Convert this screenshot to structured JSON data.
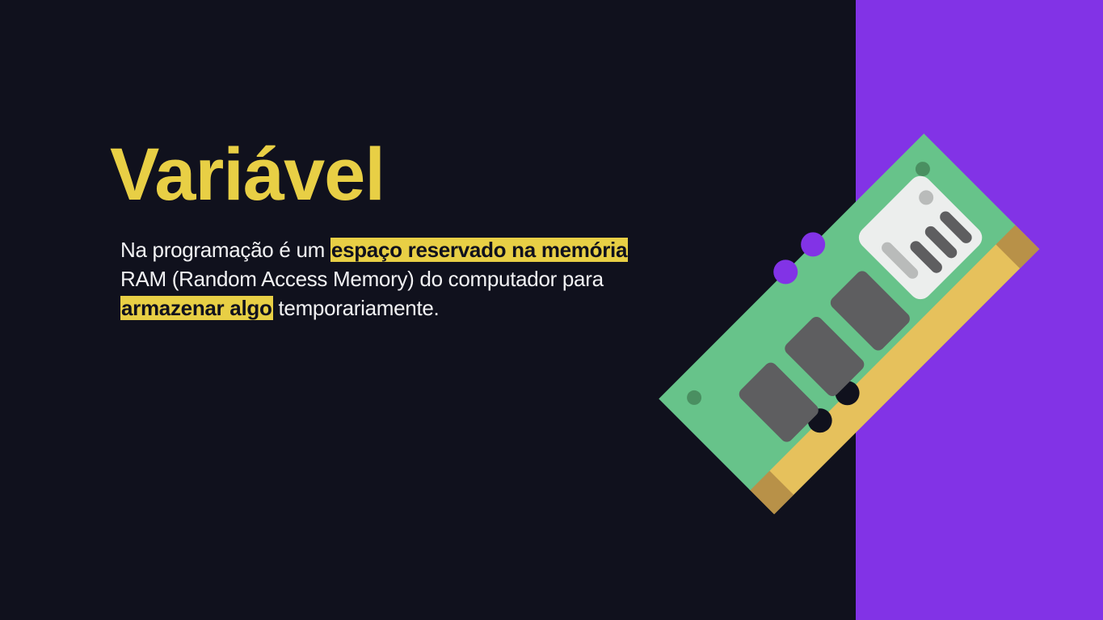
{
  "slide": {
    "title": "Variável",
    "body": {
      "t1": "Na programação é um ",
      "h1": "espaço reservado na memória",
      "t2": "RAM (Random Access Memory) do computador para",
      "h2": "armazenar algo",
      "t3": " temporariamente."
    }
  },
  "colors": {
    "background": "#10111d",
    "panel": "#8233e6",
    "accent_yellow": "#e8cf45",
    "text": "#f2f2f4",
    "ram_board": "#67c38a",
    "ram_contacts": "#e6c15c",
    "ram_chip": "#5e5e60"
  },
  "icons": {
    "illustration": "ram-memory-module-icon"
  }
}
